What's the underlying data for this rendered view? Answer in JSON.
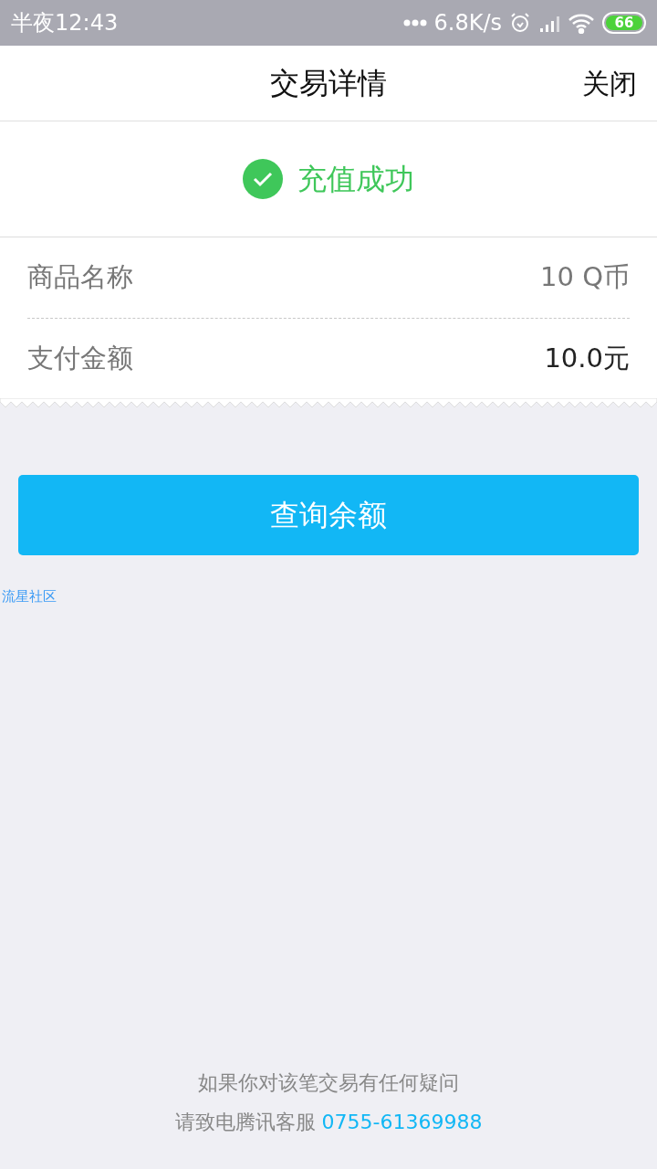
{
  "status_bar": {
    "time": "半夜12:43",
    "speed": "6.8K/s",
    "battery": "66"
  },
  "header": {
    "title": "交易详情",
    "close": "关闭"
  },
  "result": {
    "text": "充值成功",
    "success": true
  },
  "details": [
    {
      "label": "商品名称",
      "value": "10 Q币",
      "emphasized": false
    },
    {
      "label": "支付金额",
      "value": "10.0元",
      "emphasized": true
    }
  ],
  "button": "查询余额",
  "link": "流星社区",
  "footer": {
    "line1": "如果你对该笔交易有任何疑问",
    "line2": "请致电腾讯客服",
    "phone": "0755-61369988"
  }
}
